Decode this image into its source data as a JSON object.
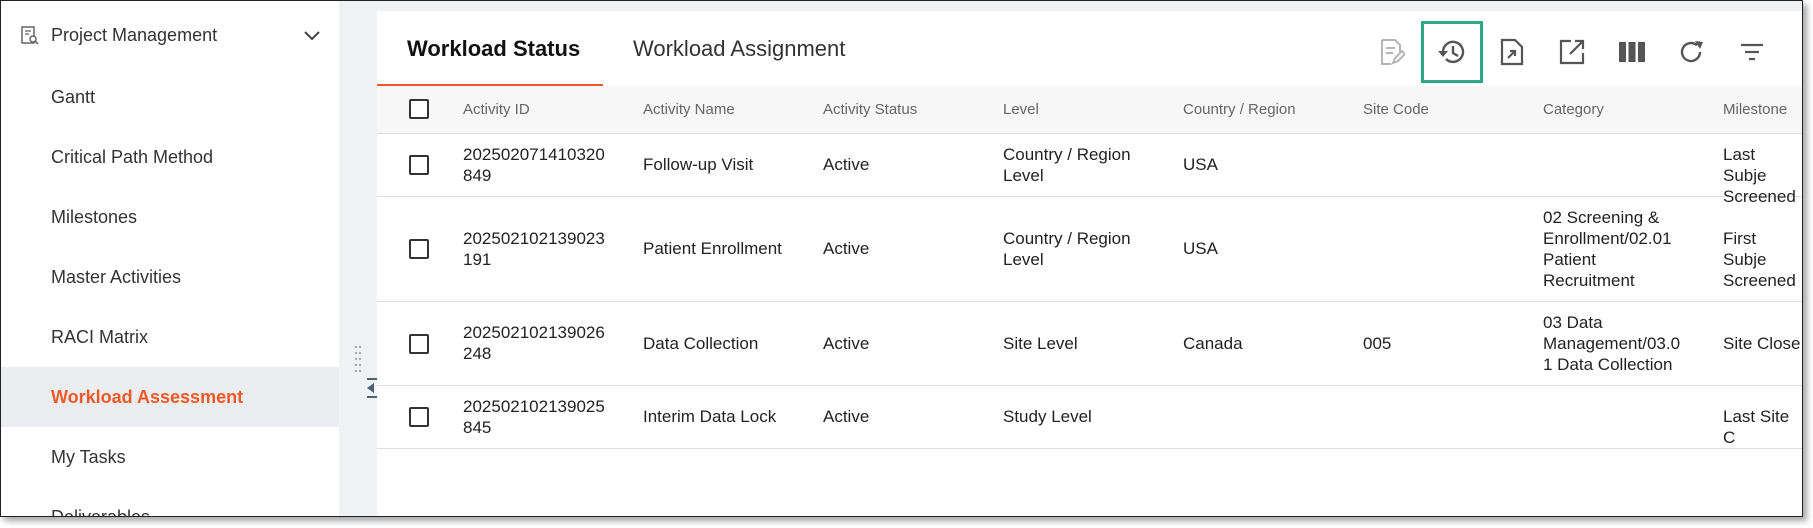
{
  "sidebar": {
    "header_title": "Project Management",
    "items": [
      {
        "label": "Gantt"
      },
      {
        "label": "Critical Path Method"
      },
      {
        "label": "Milestones"
      },
      {
        "label": "Master Activities"
      },
      {
        "label": "RACI Matrix"
      },
      {
        "label": "Workload Assessment",
        "active": true
      },
      {
        "label": "My Tasks"
      },
      {
        "label": "Deliverables"
      }
    ]
  },
  "tabs": [
    {
      "label": "Workload Status",
      "active": true
    },
    {
      "label": "Workload Assignment"
    }
  ],
  "toolbar": {
    "icons": [
      "edit-document-icon",
      "history-icon",
      "export-icon",
      "open-external-icon",
      "columns-icon",
      "refresh-icon",
      "filter-icon"
    ],
    "highlight_color": "#2fa88a"
  },
  "colors": {
    "accent": "#f05a28",
    "active_bg": "#ebedf0"
  },
  "table": {
    "columns": [
      "Activity ID",
      "Activity Name",
      "Activity Status",
      "Level",
      "Country / Region",
      "Site Code",
      "Category",
      "Milestone"
    ],
    "rows": [
      {
        "id": "202502071410320\n849",
        "name": "Follow-up Visit",
        "status": "Active",
        "level": "Country / Region\nLevel",
        "country": "USA",
        "site": "",
        "category": "",
        "milestone": "Last Subje\nScreened"
      },
      {
        "id": "202502102139023\n191",
        "name": "Patient Enrollment",
        "status": "Active",
        "level": "Country / Region\nLevel",
        "country": "USA",
        "site": "",
        "category": "02 Screening &\nEnrollment/02.01\nPatient\nRecruitment",
        "milestone": "First Subje\nScreened"
      },
      {
        "id": "202502102139026\n248",
        "name": "Data Collection",
        "status": "Active",
        "level": "Site Level",
        "country": "Canada",
        "site": "005",
        "category": "03 Data\nManagement/03.0\n1 Data Collection",
        "milestone": "Site Close"
      },
      {
        "id": "202502102139025\n845",
        "name": "Interim Data Lock",
        "status": "Active",
        "level": "Study Level",
        "country": "",
        "site": "",
        "category": "",
        "milestone": "Last Site C"
      }
    ]
  }
}
